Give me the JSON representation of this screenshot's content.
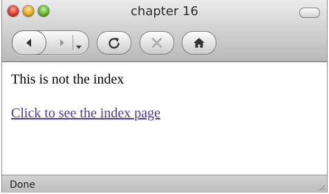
{
  "window": {
    "title": "chapter 16"
  },
  "toolbar": {
    "back_icon": "back-arrow-icon",
    "forward_icon": "forward-arrow-icon",
    "history_menu_icon": "chevron-down-icon",
    "reload_icon": "reload-icon",
    "stop_icon": "stop-icon",
    "home_icon": "home-icon"
  },
  "content": {
    "message": "This is not the index",
    "link_text": "Click to see the index page",
    "link_color": "#4b3a92"
  },
  "statusbar": {
    "text": "Done"
  },
  "colors": {
    "close": "#e8473a",
    "minimize": "#f0b22c",
    "zoom": "#6fbe3a"
  }
}
